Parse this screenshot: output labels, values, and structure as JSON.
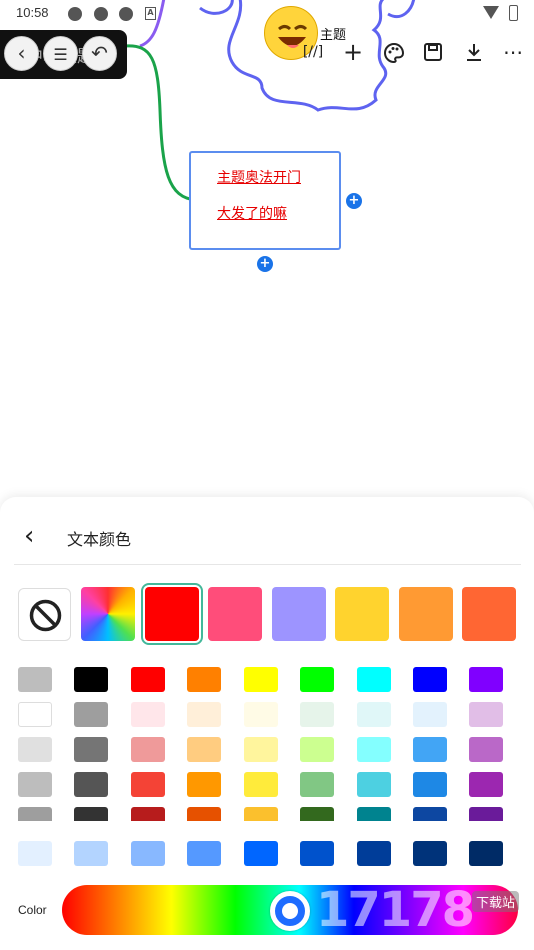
{
  "status_bar": {
    "time": "10:58",
    "icons": [
      "notification-icon",
      "notification-icon",
      "notification-icon",
      "a-icon",
      "wifi-icon",
      "battery-icon"
    ]
  },
  "mindmap": {
    "root_topic": "主题",
    "floating_title": "中心主题",
    "node": {
      "line1": "主题奥法开门",
      "line2": "大发了的嘛"
    },
    "colors": {
      "root_border": "#5e63f0",
      "branch_upper": "#8a5cf0",
      "branch_green": "#1aa34a",
      "node_border": "#5b8def",
      "node_text": "#e60000",
      "add_button": "#1a73e8"
    }
  },
  "toolbar": {
    "icons": [
      "formula-icon",
      "add-icon",
      "palette-icon",
      "save-icon",
      "download-icon",
      "more-icon"
    ],
    "formula_label": "[//]",
    "add_label": "+",
    "more_label": "⋯"
  },
  "panel": {
    "title": "文本颜色",
    "top_swatches": [
      "#ff0000",
      "#ff4d7a",
      "#9d94ff",
      "#ffd32e",
      "#ff9a33",
      "#ff6633"
    ],
    "selected_swatch_index": 0,
    "grid": [
      [
        "#bdbdbd",
        "#000000",
        "#ff0000",
        "#ff8000",
        "#ffff00",
        "#00ff00",
        "#00ffff",
        "#0000ff",
        "#8000ff"
      ],
      [
        "#ffffff",
        "#9e9e9e",
        "#ffe6ea",
        "#ffefd9",
        "#fffbe6",
        "#e6f4ea",
        "#e0f7f8",
        "#e3f2fd",
        "#e1bee7"
      ],
      [
        "#e0e0e0",
        "#757575",
        "#ef9a9a",
        "#ffcc80",
        "#fff59d",
        "#ccff90",
        "#84ffff",
        "#42a5f5",
        "#ba68c8"
      ],
      [
        "#bdbdbd",
        "#555555",
        "#f44336",
        "#ff9800",
        "#ffeb3b",
        "#81c784",
        "#4dd0e1",
        "#1e88e5",
        "#9c27b0"
      ],
      [
        "#9e9e9e",
        "#333333",
        "#b71c1c",
        "#e65100",
        "#fbc02d",
        "#33691e",
        "#00838f",
        "#0d47a1",
        "#6a1b9a"
      ],
      [
        "#e3f0ff",
        "#b3d4ff",
        "#88b8ff",
        "#5599ff",
        "#0066ff",
        "#0052cc",
        "#003d99",
        "#00337a",
        "#002b66"
      ]
    ],
    "color_label": "Color",
    "hue_level": 0.5
  },
  "watermark": {
    "text": "17178",
    "badge": "下载站"
  }
}
